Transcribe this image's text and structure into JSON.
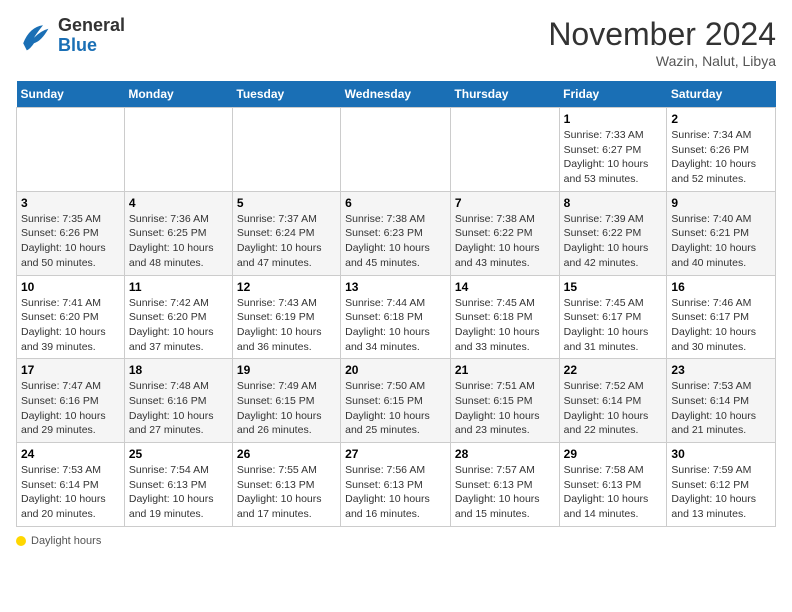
{
  "header": {
    "logo_line1": "General",
    "logo_line2": "Blue",
    "month": "November 2024",
    "location": "Wazin, Nalut, Libya"
  },
  "days_of_week": [
    "Sunday",
    "Monday",
    "Tuesday",
    "Wednesday",
    "Thursday",
    "Friday",
    "Saturday"
  ],
  "weeks": [
    [
      {
        "day": "",
        "info": ""
      },
      {
        "day": "",
        "info": ""
      },
      {
        "day": "",
        "info": ""
      },
      {
        "day": "",
        "info": ""
      },
      {
        "day": "",
        "info": ""
      },
      {
        "day": "1",
        "info": "Sunrise: 7:33 AM\nSunset: 6:27 PM\nDaylight: 10 hours and 53 minutes."
      },
      {
        "day": "2",
        "info": "Sunrise: 7:34 AM\nSunset: 6:26 PM\nDaylight: 10 hours and 52 minutes."
      }
    ],
    [
      {
        "day": "3",
        "info": "Sunrise: 7:35 AM\nSunset: 6:26 PM\nDaylight: 10 hours and 50 minutes."
      },
      {
        "day": "4",
        "info": "Sunrise: 7:36 AM\nSunset: 6:25 PM\nDaylight: 10 hours and 48 minutes."
      },
      {
        "day": "5",
        "info": "Sunrise: 7:37 AM\nSunset: 6:24 PM\nDaylight: 10 hours and 47 minutes."
      },
      {
        "day": "6",
        "info": "Sunrise: 7:38 AM\nSunset: 6:23 PM\nDaylight: 10 hours and 45 minutes."
      },
      {
        "day": "7",
        "info": "Sunrise: 7:38 AM\nSunset: 6:22 PM\nDaylight: 10 hours and 43 minutes."
      },
      {
        "day": "8",
        "info": "Sunrise: 7:39 AM\nSunset: 6:22 PM\nDaylight: 10 hours and 42 minutes."
      },
      {
        "day": "9",
        "info": "Sunrise: 7:40 AM\nSunset: 6:21 PM\nDaylight: 10 hours and 40 minutes."
      }
    ],
    [
      {
        "day": "10",
        "info": "Sunrise: 7:41 AM\nSunset: 6:20 PM\nDaylight: 10 hours and 39 minutes."
      },
      {
        "day": "11",
        "info": "Sunrise: 7:42 AM\nSunset: 6:20 PM\nDaylight: 10 hours and 37 minutes."
      },
      {
        "day": "12",
        "info": "Sunrise: 7:43 AM\nSunset: 6:19 PM\nDaylight: 10 hours and 36 minutes."
      },
      {
        "day": "13",
        "info": "Sunrise: 7:44 AM\nSunset: 6:18 PM\nDaylight: 10 hours and 34 minutes."
      },
      {
        "day": "14",
        "info": "Sunrise: 7:45 AM\nSunset: 6:18 PM\nDaylight: 10 hours and 33 minutes."
      },
      {
        "day": "15",
        "info": "Sunrise: 7:45 AM\nSunset: 6:17 PM\nDaylight: 10 hours and 31 minutes."
      },
      {
        "day": "16",
        "info": "Sunrise: 7:46 AM\nSunset: 6:17 PM\nDaylight: 10 hours and 30 minutes."
      }
    ],
    [
      {
        "day": "17",
        "info": "Sunrise: 7:47 AM\nSunset: 6:16 PM\nDaylight: 10 hours and 29 minutes."
      },
      {
        "day": "18",
        "info": "Sunrise: 7:48 AM\nSunset: 6:16 PM\nDaylight: 10 hours and 27 minutes."
      },
      {
        "day": "19",
        "info": "Sunrise: 7:49 AM\nSunset: 6:15 PM\nDaylight: 10 hours and 26 minutes."
      },
      {
        "day": "20",
        "info": "Sunrise: 7:50 AM\nSunset: 6:15 PM\nDaylight: 10 hours and 25 minutes."
      },
      {
        "day": "21",
        "info": "Sunrise: 7:51 AM\nSunset: 6:15 PM\nDaylight: 10 hours and 23 minutes."
      },
      {
        "day": "22",
        "info": "Sunrise: 7:52 AM\nSunset: 6:14 PM\nDaylight: 10 hours and 22 minutes."
      },
      {
        "day": "23",
        "info": "Sunrise: 7:53 AM\nSunset: 6:14 PM\nDaylight: 10 hours and 21 minutes."
      }
    ],
    [
      {
        "day": "24",
        "info": "Sunrise: 7:53 AM\nSunset: 6:14 PM\nDaylight: 10 hours and 20 minutes."
      },
      {
        "day": "25",
        "info": "Sunrise: 7:54 AM\nSunset: 6:13 PM\nDaylight: 10 hours and 19 minutes."
      },
      {
        "day": "26",
        "info": "Sunrise: 7:55 AM\nSunset: 6:13 PM\nDaylight: 10 hours and 17 minutes."
      },
      {
        "day": "27",
        "info": "Sunrise: 7:56 AM\nSunset: 6:13 PM\nDaylight: 10 hours and 16 minutes."
      },
      {
        "day": "28",
        "info": "Sunrise: 7:57 AM\nSunset: 6:13 PM\nDaylight: 10 hours and 15 minutes."
      },
      {
        "day": "29",
        "info": "Sunrise: 7:58 AM\nSunset: 6:13 PM\nDaylight: 10 hours and 14 minutes."
      },
      {
        "day": "30",
        "info": "Sunrise: 7:59 AM\nSunset: 6:12 PM\nDaylight: 10 hours and 13 minutes."
      }
    ]
  ],
  "legend": {
    "daylight_label": "Daylight hours"
  }
}
